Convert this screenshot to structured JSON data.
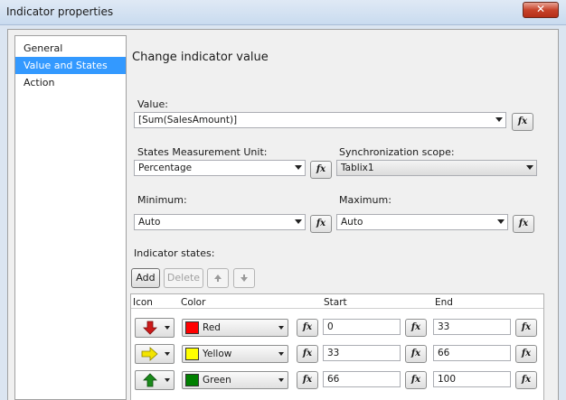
{
  "window": {
    "title": "Indicator properties",
    "close_label": "✕"
  },
  "nav": {
    "items": [
      {
        "label": "General"
      },
      {
        "label": "Value and States"
      },
      {
        "label": "Action"
      }
    ]
  },
  "main": {
    "heading": "Change indicator value",
    "value": {
      "label": "Value:",
      "text": "[Sum(SalesAmount)]"
    },
    "measurement": {
      "label": "States Measurement Unit:",
      "text": "Percentage"
    },
    "sync": {
      "label": "Synchronization scope:",
      "text": "Tablix1"
    },
    "minimum": {
      "label": "Minimum:",
      "text": "Auto"
    },
    "maximum": {
      "label": "Maximum:",
      "text": "Auto"
    },
    "fx_label": "fx",
    "states": {
      "label": "Indicator states:",
      "add_label": "Add",
      "delete_label": "Delete",
      "move_up_icon": "arrow-up-icon",
      "move_down_icon": "arrow-down-icon",
      "headers": {
        "icon": "Icon",
        "color": "Color",
        "start": "Start",
        "end": "End"
      },
      "rows": [
        {
          "icon": "red-down-arrow",
          "icon_color": "#cc1a1a",
          "color_name": "Red",
          "color": "#ff0000",
          "start": "0",
          "end": "33"
        },
        {
          "icon": "yellow-right-arrow",
          "icon_color": "#f2e400",
          "color_name": "Yellow",
          "color": "#ffff00",
          "start": "33",
          "end": "66"
        },
        {
          "icon": "green-up-arrow",
          "icon_color": "#1a8a1a",
          "color_name": "Green",
          "color": "#008000",
          "start": "66",
          "end": "100"
        }
      ]
    }
  }
}
